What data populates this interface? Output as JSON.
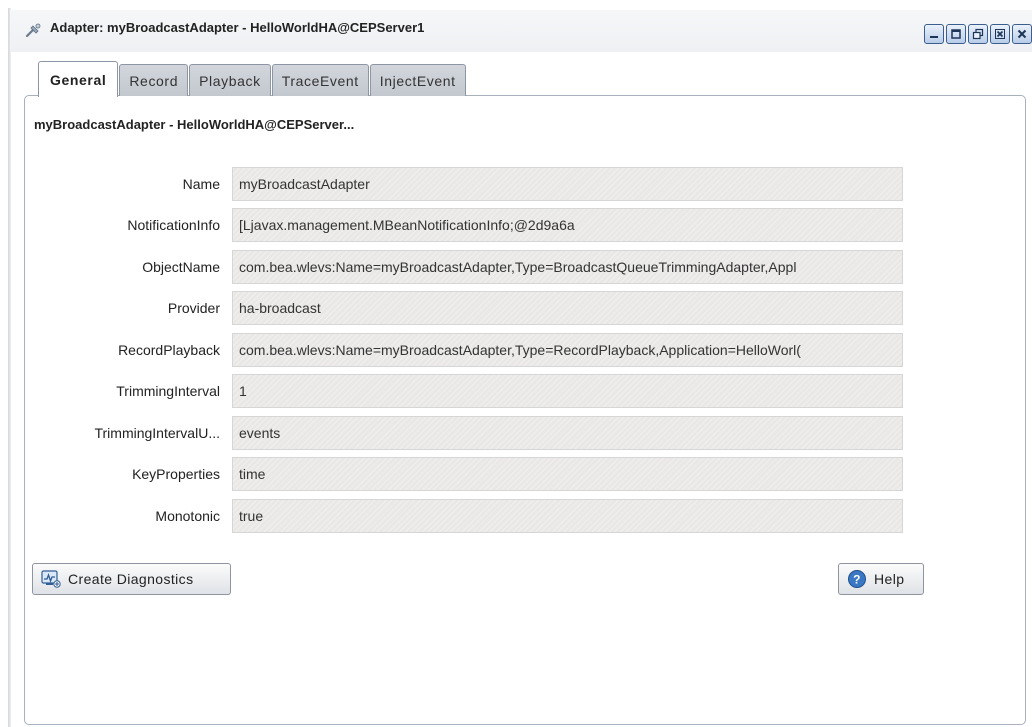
{
  "window": {
    "title": "Adapter: myBroadcastAdapter - HelloWorldHA@CEPServer1",
    "icon": "adapter-icon",
    "controls": [
      "minimize-icon",
      "maximize-icon",
      "restore-icon",
      "close-all-icon",
      "close-icon"
    ]
  },
  "tabs": [
    {
      "label": "General",
      "active": true
    },
    {
      "label": "Record",
      "active": false
    },
    {
      "label": "Playback",
      "active": false
    },
    {
      "label": "TraceEvent",
      "active": false
    },
    {
      "label": "InjectEvent",
      "active": false
    }
  ],
  "panel": {
    "heading": "myBroadcastAdapter - HelloWorldHA@CEPServer...",
    "properties": [
      {
        "label": "Name",
        "value": "myBroadcastAdapter"
      },
      {
        "label": "NotificationInfo",
        "value": "[Ljavax.management.MBeanNotificationInfo;@2d9a6a"
      },
      {
        "label": "ObjectName",
        "value": "com.bea.wlevs:Name=myBroadcastAdapter,Type=BroadcastQueueTrimmingAdapter,Appl"
      },
      {
        "label": "Provider",
        "value": "ha-broadcast"
      },
      {
        "label": "RecordPlayback",
        "value": "com.bea.wlevs:Name=myBroadcastAdapter,Type=RecordPlayback,Application=HelloWorl("
      },
      {
        "label": "TrimmingInterval",
        "value": "1"
      },
      {
        "label": "TrimmingIntervalU...",
        "value": "events"
      },
      {
        "label": "KeyProperties",
        "value": "time"
      },
      {
        "label": "Monotonic",
        "value": "true"
      }
    ]
  },
  "buttons": {
    "create_diagnostics": "Create Diagnostics",
    "help": "Help"
  },
  "colors": {
    "field_background": "#e9e8e6",
    "tab_inactive": "#c8ccd2",
    "window_button": "#b9cde9"
  }
}
